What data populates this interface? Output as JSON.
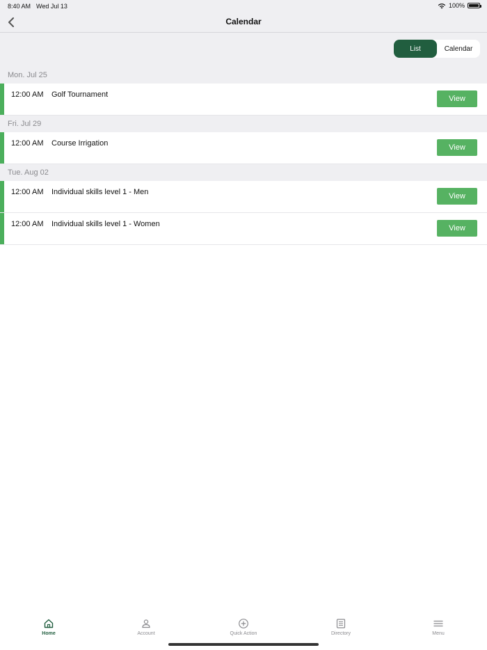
{
  "status_bar": {
    "time": "8:40 AM",
    "date": "Wed Jul 13",
    "battery": "100%"
  },
  "navbar": {
    "title": "Calendar"
  },
  "segment": {
    "list_label": "List",
    "calendar_label": "Calendar",
    "selected": "List"
  },
  "days": [
    {
      "label": "Mon. Jul 25",
      "events": [
        {
          "time": "12:00 AM",
          "title": "Golf Tournament",
          "action": "View"
        }
      ]
    },
    {
      "label": "Fri. Jul 29",
      "events": [
        {
          "time": "12:00 AM",
          "title": "Course Irrigation",
          "action": "View"
        }
      ]
    },
    {
      "label": "Tue. Aug 02",
      "events": [
        {
          "time": "12:00 AM",
          "title": "Individual skills level 1 - Men",
          "action": "View"
        },
        {
          "time": "12:00 AM",
          "title": "Individual skills level 1 - Women",
          "action": "View"
        }
      ]
    }
  ],
  "tabbar": {
    "tabs": [
      {
        "label": "Home",
        "icon": "home-icon",
        "active": true
      },
      {
        "label": "Account",
        "icon": "person-icon",
        "active": false
      },
      {
        "label": "Quick Action",
        "icon": "plus-circle-icon",
        "active": false
      },
      {
        "label": "Directory",
        "icon": "list-icon",
        "active": false
      },
      {
        "label": "Menu",
        "icon": "hamburger-icon",
        "active": false
      }
    ]
  },
  "colors": {
    "accent_dark": "#215e3f",
    "accent_green": "#56b262",
    "event_bar": "#4caf5c"
  }
}
